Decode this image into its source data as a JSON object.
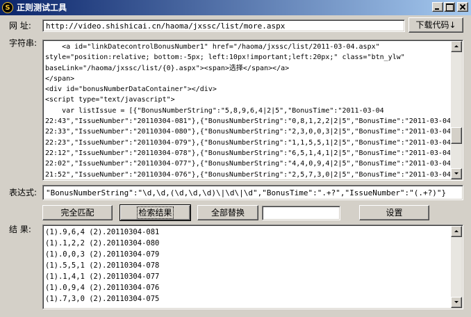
{
  "window": {
    "title": "正则测试工具",
    "app_icon_glyph": "S",
    "icon_name": "app-icon"
  },
  "url_row": {
    "label": "网  址:",
    "value": "http://video.shishicai.cn/haoma/jxssc/list/more.aspx",
    "download_button": "下载代码↓"
  },
  "source": {
    "label": "字符串:",
    "lines": [
      "    <a id=\"linkDatecontrolBonusNumber1\" href=\"/haoma/jxssc/list/2011-03-04.aspx\"",
      "style=\"position:relative; bottom:-5px; left:10px!important;left:20px;\" class=\"btn_ylw\"",
      "baseLink=\"/haoma/jxssc/list/{0}.aspx\"><span>选择</span></a>",
      "</span>",
      "<div id=\"bonusNumberDataContainer\"></div>",
      "<script type=\"text/javascript\">",
      "    var listIssue = [{\"BonusNumberString\":\"5,8,9,6,4|2|5\",\"BonusTime\":\"2011-03-04",
      "22:43\",\"IssueNumber\":\"20110304-081\"},{\"BonusNumberString\":\"0,8,1,2,2|2|5\",\"BonusTime\":\"2011-03-04",
      "22:33\",\"IssueNumber\":\"20110304-080\"},{\"BonusNumberString\":\"2,3,0,0,3|2|5\",\"BonusTime\":\"2011-03-04",
      "22:23\",\"IssueNumber\":\"20110304-079\"},{\"BonusNumberString\":\"1,1,5,5,1|2|5\",\"BonusTime\":\"2011-03-04",
      "22:12\",\"IssueNumber\":\"20110304-078\"},{\"BonusNumberString\":\"6,5,1,4,1|2|5\",\"BonusTime\":\"2011-03-04",
      "22:02\",\"IssueNumber\":\"20110304-077\"},{\"BonusNumberString\":\"4,4,0,9,4|2|5\",\"BonusTime\":\"2011-03-04",
      "21:52\",\"IssueNumber\":\"20110304-076\"},{\"BonusNumberString\":\"2,5,7,3,0|2|5\",\"BonusTime\":\"2011-03-04"
    ]
  },
  "expression": {
    "label": "表达式:",
    "value": "\"BonusNumberString\":\"\\d,\\d,(\\d,\\d,\\d)\\|\\d\\|\\d\",\"BonusTime\":\".+?\",\"IssueNumber\":\"(.+?)\"}"
  },
  "actions": {
    "full_match": "完全匹配",
    "search_results": "检索结果",
    "replace_all": "全部替换",
    "replace_value": "",
    "settings": "设置"
  },
  "results": {
    "label": "结  果:",
    "lines": [
      "(1).9,6,4 (2).20110304-081",
      "(1).1,2,2 (2).20110304-080",
      "(1).0,0,3 (2).20110304-079",
      "(1).5,5,1 (2).20110304-078",
      "(1).1,4,1 (2).20110304-077",
      "(1).0,9,4 (2).20110304-076",
      "(1).7,3,0 (2).20110304-075"
    ]
  },
  "colors": {
    "titlebar_start": "#0a246a",
    "titlebar_end": "#a6caf0",
    "face": "#d4d0c8"
  }
}
